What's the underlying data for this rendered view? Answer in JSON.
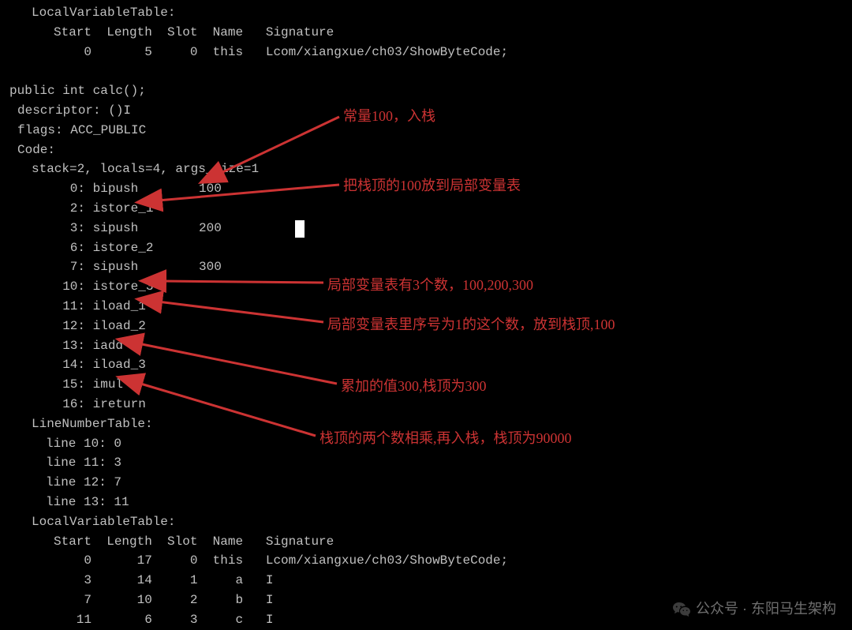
{
  "header_table": {
    "title": "LocalVariableTable:",
    "cols": "Start  Length  Slot  Name   Signature",
    "row": "    0       5     0  this   Lcom/xiangxue/ch03/ShowByteCode;"
  },
  "method_decl": "public int calc();",
  "descriptor": "descriptor: ()I",
  "flags": "flags: ACC_PUBLIC",
  "code_label": "Code:",
  "stack_line": "stack=2, locals=4, args_size=1",
  "bytecode": [
    "   0: bipush        100",
    "   2: istore_1",
    "   3: sipush        200",
    "   6: istore_2",
    "   7: sipush        300",
    "  10: istore_3",
    "  11: iload_1",
    "  12: iload_2",
    "  13: iadd",
    "  14: iload_3",
    "  15: imul",
    "  16: ireturn"
  ],
  "lnt_label": "LineNumberTable:",
  "lnt": [
    "line 10: 0",
    "line 11: 3",
    "line 12: 7",
    "line 13: 11"
  ],
  "lvt_label": "LocalVariableTable:",
  "lvt_cols": "Start  Length  Slot  Name   Signature",
  "lvt_rows": [
    "    0      17     0  this   Lcom/xiangxue/ch03/ShowByteCode;",
    "    3      14     1     a   I",
    "    7      10     2     b   I",
    "   11       6     3     c   I"
  ],
  "annotations": {
    "a1": "常量100，入栈",
    "a2": "把栈顶的100放到局部变量表",
    "a3": "局部变量表有3个数，100,200,300",
    "a4": "局部变量表里序号为1的这个数，放到栈顶,100",
    "a5": "累加的值300,栈顶为300",
    "a6": "栈顶的两个数相乘,再入栈，栈顶为90000"
  },
  "watermark": "公众号 · 东阳马生架构"
}
